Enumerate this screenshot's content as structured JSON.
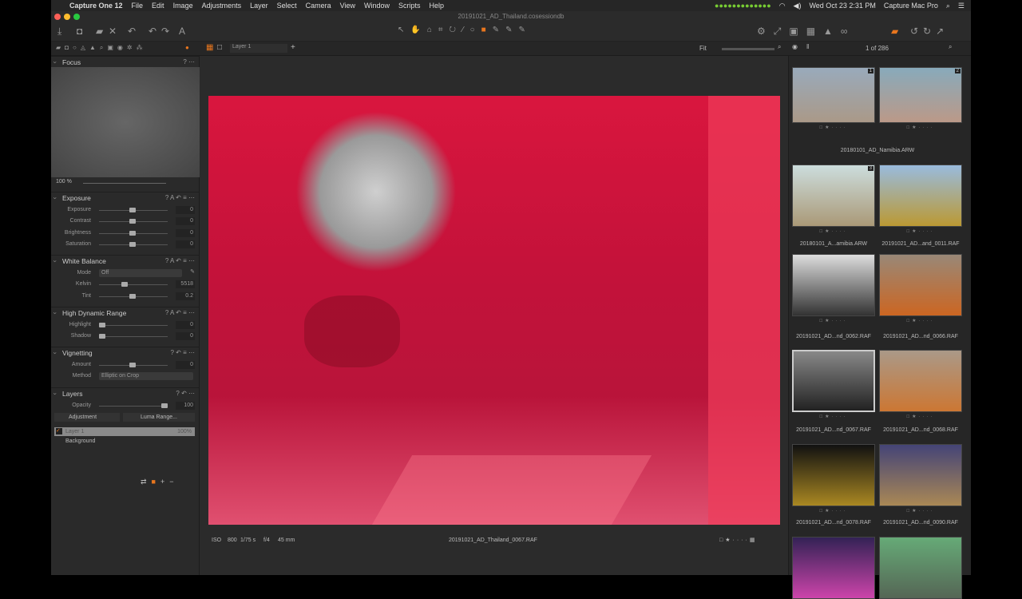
{
  "menubar": {
    "app": "Capture One 12",
    "items": [
      "File",
      "Edit",
      "Image",
      "Adjustments",
      "Layer",
      "Select",
      "Camera",
      "View",
      "Window",
      "Scripts",
      "Help"
    ],
    "clock": "Wed Oct 23  2:31 PM",
    "user": "Capture Mac Pro"
  },
  "window": {
    "title": "20191021_AD_Thailand.cosessiondb"
  },
  "viewer": {
    "layer_select": "Layer 1",
    "zoom_label": "Fit",
    "counter": "1 of 286",
    "iso": "ISO 800",
    "shutter": "1/75 s",
    "aperture": "f/4",
    "focal": "45 mm",
    "filename": "20191021_AD_Thailand_0067.RAF"
  },
  "focus": {
    "title": "Focus",
    "zoom": "100 %"
  },
  "exposure": {
    "title": "Exposure",
    "rows": [
      {
        "label": "Exposure",
        "value": "0"
      },
      {
        "label": "Contrast",
        "value": "0"
      },
      {
        "label": "Brightness",
        "value": "0"
      },
      {
        "label": "Saturation",
        "value": "0"
      }
    ]
  },
  "white_balance": {
    "title": "White Balance",
    "mode_label": "Mode",
    "mode": "Off",
    "kelvin_label": "Kelvin",
    "kelvin": "5518",
    "tint_label": "Tint",
    "tint": "0.2"
  },
  "hdr": {
    "title": "High Dynamic Range",
    "rows": [
      {
        "label": "Highlight",
        "value": "0"
      },
      {
        "label": "Shadow",
        "value": "0"
      }
    ]
  },
  "vignetting": {
    "title": "Vignetting",
    "amount_label": "Amount",
    "amount": "0",
    "method_label": "Method",
    "method": "Elliptic on Crop"
  },
  "layers": {
    "title": "Layers",
    "opacity_label": "Opacity",
    "opacity": "100",
    "type": "Adjustment",
    "luma": "Luma Range...",
    "items": [
      {
        "name": "Layer 1",
        "opacity": "100%"
      },
      {
        "name": "Background"
      }
    ]
  },
  "browser": {
    "thumbs": [
      {
        "caption": "20180101_AD_Namibia.ARW",
        "badge": "1",
        "colors": [
          "#9ab",
          "#a98"
        ]
      },
      {
        "caption": "",
        "badge": "2",
        "colors": [
          "#8ab",
          "#b98"
        ]
      },
      {
        "caption": "20180101_A...amibia.ARW",
        "badge": "3",
        "colors": [
          "#cdd",
          "#a97"
        ]
      },
      {
        "caption": "20191021_AD...and_0011.RAF",
        "badge": "",
        "colors": [
          "#9bd",
          "#b93"
        ]
      },
      {
        "caption": "20191021_AD...nd_0062.RAF",
        "badge": "",
        "colors": [
          "#ddd",
          "#333"
        ]
      },
      {
        "caption": "20191021_AD...nd_0066.RAF",
        "badge": "",
        "colors": [
          "#987",
          "#c62"
        ]
      },
      {
        "caption": "20191021_AD...nd_0067.RAF",
        "badge": "",
        "colors": [
          "#888",
          "#222"
        ]
      },
      {
        "caption": "20191021_AD...nd_0068.RAF",
        "badge": "",
        "colors": [
          "#a98",
          "#c73"
        ]
      },
      {
        "caption": "20191021_AD...nd_0078.RAF",
        "badge": "",
        "colors": [
          "#111",
          "#a82"
        ]
      },
      {
        "caption": "20191021_AD...nd_0090.RAF",
        "badge": "",
        "colors": [
          "#447",
          "#a85"
        ]
      },
      {
        "caption": "",
        "badge": "",
        "colors": [
          "#325",
          "#c4a"
        ]
      },
      {
        "caption": "",
        "badge": "",
        "colors": [
          "#6a7",
          "#565"
        ]
      }
    ]
  },
  "colors": {
    "accent": "#e8761e",
    "overlay": "#d9163e"
  }
}
